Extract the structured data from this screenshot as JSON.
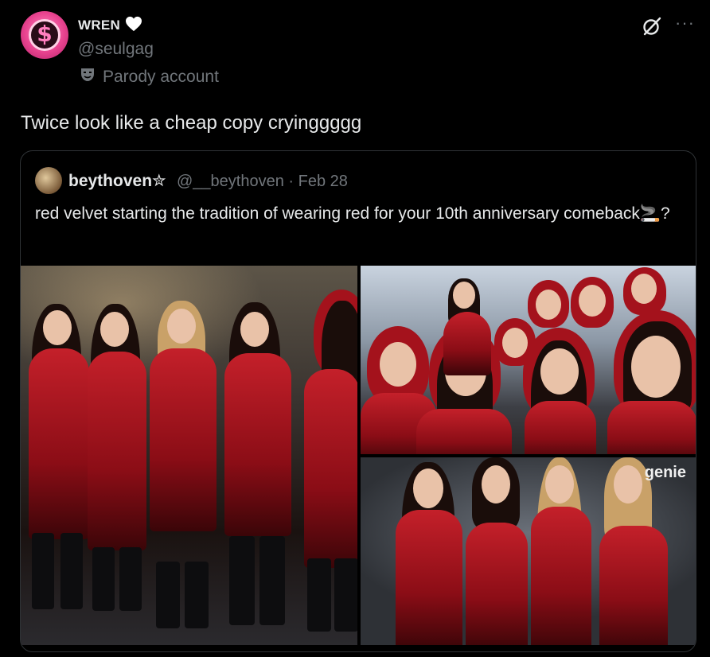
{
  "author": {
    "name": "WREN",
    "heart_icon": "white-heart-icon",
    "handle": "@seulgag",
    "label": "Parody account",
    "label_icon": "theater-mask-icon",
    "avatar_color": "#e8438f"
  },
  "actions": {
    "grok_icon": "grok-icon",
    "more_icon": "more-icon",
    "more_label": "···"
  },
  "tweet": {
    "text": "Twice look like a cheap copy cryinggggg"
  },
  "quote": {
    "name": "beythoven✮",
    "handle_date": "@__beythoven · Feb 28",
    "text": "red velvet starting the tradition of wearing red for your 10th anniversary comeback🚬?",
    "images": [
      {
        "name": "left-group-photo"
      },
      {
        "name": "top-right-group-photo"
      },
      {
        "name": "bottom-right-group-photo",
        "watermark": "genie"
      }
    ]
  },
  "colors": {
    "background": "#000000",
    "text": "#e7e9ea",
    "secondary": "#71767b",
    "border": "#2f3336",
    "outfit_red": "#c4202a"
  }
}
